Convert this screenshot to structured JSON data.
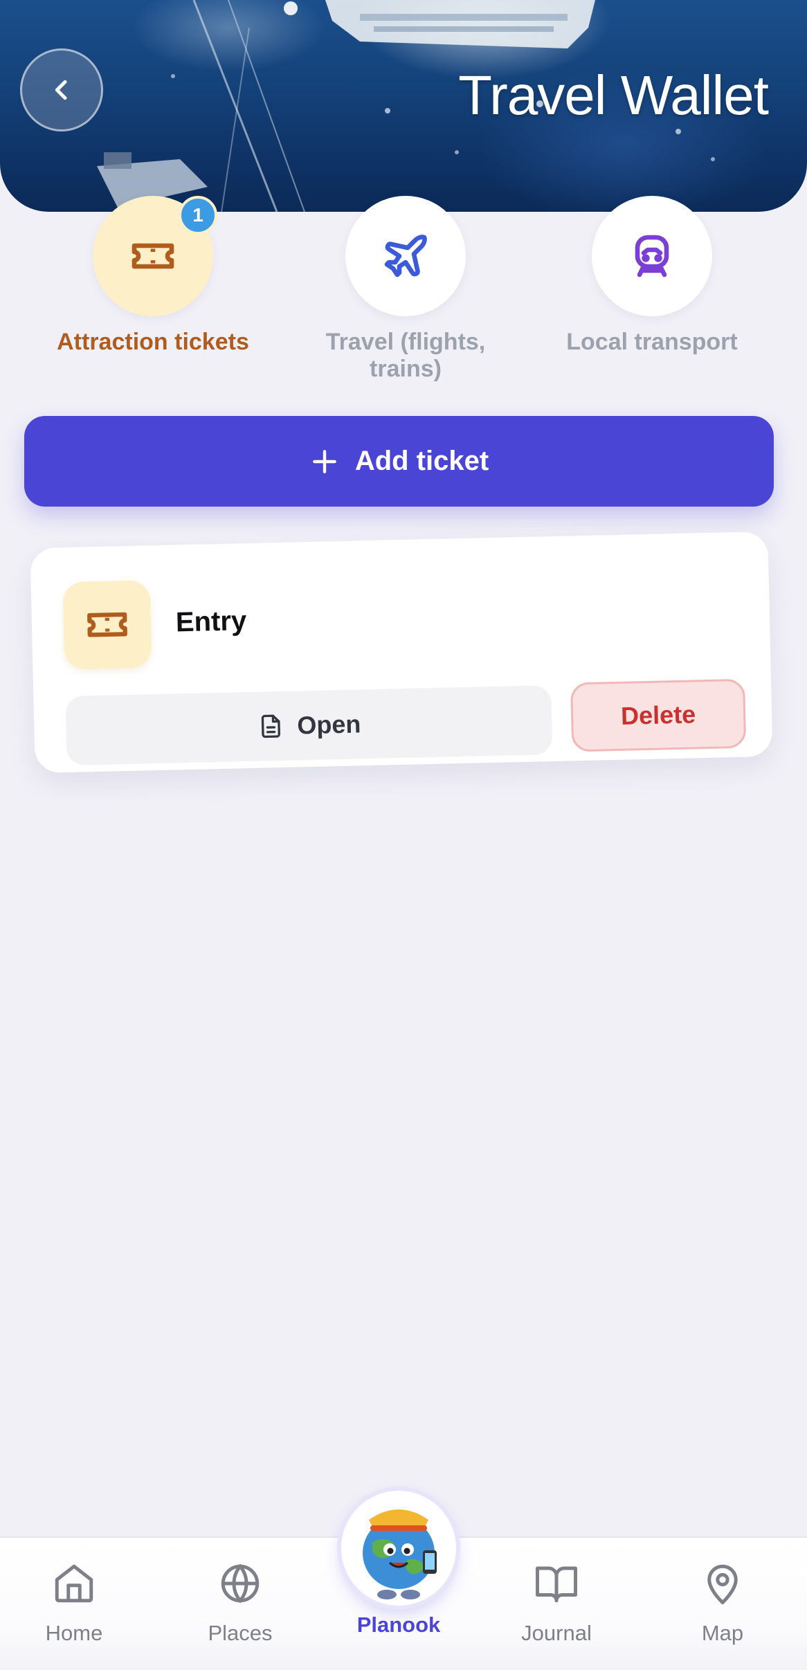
{
  "header": {
    "title": "Travel Wallet",
    "back_icon": "chevron-left-icon"
  },
  "categories": [
    {
      "label": "Attraction tickets",
      "icon": "ticket-icon",
      "active": true,
      "badge": "1",
      "color": "#b15c1f"
    },
    {
      "label": "Travel (flights, trains)",
      "icon": "airplane-icon",
      "active": false,
      "color": "#3b5bd9"
    },
    {
      "label": "Local transport",
      "icon": "train-icon",
      "active": false,
      "color": "#7b3fd6"
    }
  ],
  "add_button": {
    "label": "Add ticket",
    "icon": "plus-icon"
  },
  "tickets": [
    {
      "name": "Entry",
      "icon": "ticket-icon",
      "open_label": "Open",
      "open_icon": "document-icon",
      "delete_label": "Delete"
    }
  ],
  "bottom_nav": {
    "items": [
      {
        "label": "Home",
        "icon": "home-icon"
      },
      {
        "label": "Places",
        "icon": "globe-icon"
      },
      {
        "label": "Planook",
        "icon": "mascot-avatar",
        "active": true
      },
      {
        "label": "Journal",
        "icon": "book-icon"
      },
      {
        "label": "Map",
        "icon": "map-pin-icon"
      }
    ]
  },
  "colors": {
    "accent": "#4b45d6",
    "background": "#f1f0f7",
    "active_tab_bg": "#fdf0c8",
    "danger": "#c9312f",
    "badge": "#3d9be4"
  }
}
